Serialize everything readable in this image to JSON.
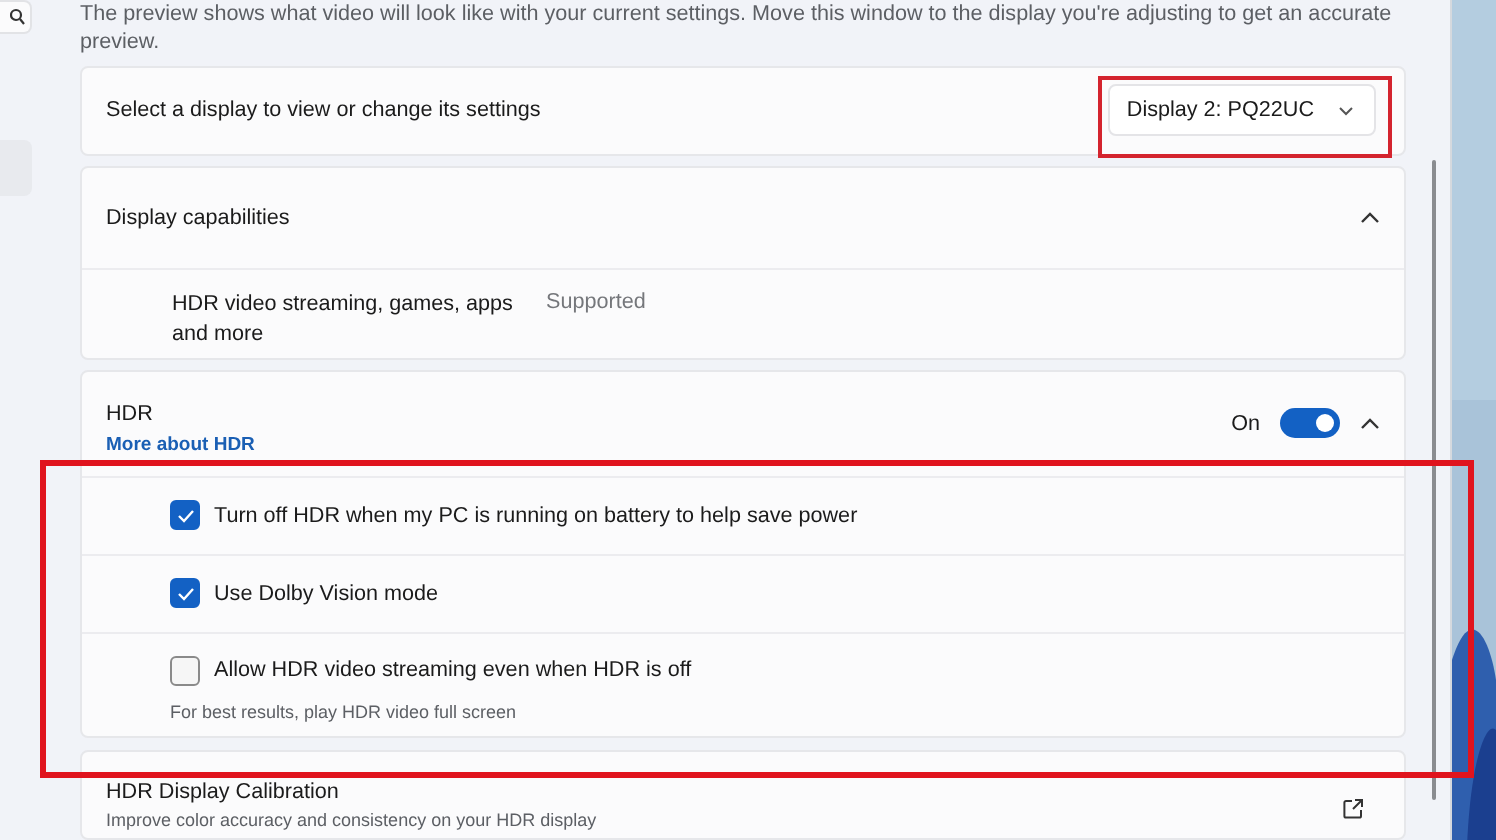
{
  "intro": "The preview shows what video will look like with your current settings. Move this window to the display you're adjusting to get an accurate preview.",
  "display_select": {
    "label": "Select a display to view or change its settings",
    "value": "Display 2: PQ22UC"
  },
  "capabilities": {
    "title": "Display capabilities",
    "expanded": true,
    "items": [
      {
        "name": "HDR video streaming, games, apps and more",
        "value": "Supported"
      }
    ]
  },
  "hdr": {
    "title": "HDR",
    "link": "More about HDR",
    "state_label": "On",
    "on": true,
    "expanded": true,
    "options": [
      {
        "label": "Turn off HDR when my PC is running on battery to help save power",
        "checked": true
      },
      {
        "label": "Use Dolby Vision mode",
        "checked": true
      },
      {
        "label": "Allow HDR video streaming even when HDR is off",
        "checked": false,
        "hint": "For best results, play HDR video full screen"
      }
    ]
  },
  "calibration": {
    "title": "HDR Display Calibration",
    "description": "Improve color accuracy and consistency on your HDR display"
  }
}
